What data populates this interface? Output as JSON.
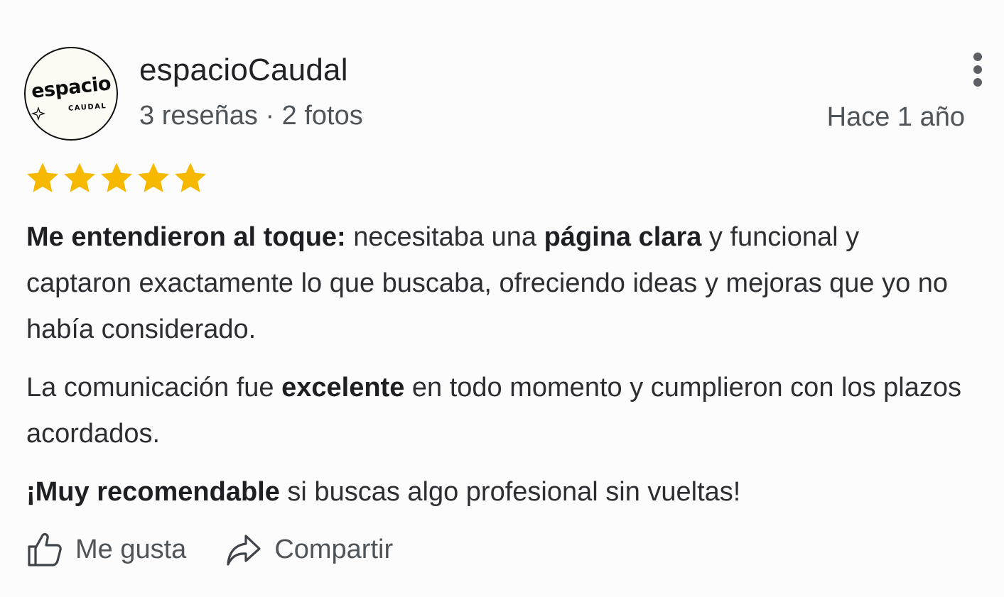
{
  "review": {
    "author": {
      "name": "espacioCaudal",
      "stats": "3 reseñas · 2 fotos",
      "avatar_logo": {
        "word": "espacio",
        "sub": "CAUDAL"
      }
    },
    "time": "Hace 1 año",
    "rating": 5,
    "paragraphs": {
      "p1": {
        "b1": "Me entendieron al toque:",
        "t1": " necesitaba una ",
        "b2": "página clara",
        "t2": " y funcional y captaron exactamente lo que buscaba, ofreciendo ideas y mejoras que yo no había considerado."
      },
      "p2": {
        "t1": "La comunicación fue ",
        "b1": "excelente",
        "t2": " en todo momento y cumplieron con los plazos acordados."
      },
      "p3": {
        "b1": "¡Muy recomendable",
        "t1": " si buscas algo profesional sin vueltas!"
      }
    },
    "actions": {
      "like_label": "Me gusta",
      "share_label": "Compartir"
    }
  },
  "colors": {
    "star": "#f7b900",
    "text_primary": "#202226",
    "text_secondary": "#4f5459"
  },
  "icons": [
    "more-vert-icon",
    "star-icon",
    "thumb-up-icon",
    "share-icon"
  ]
}
